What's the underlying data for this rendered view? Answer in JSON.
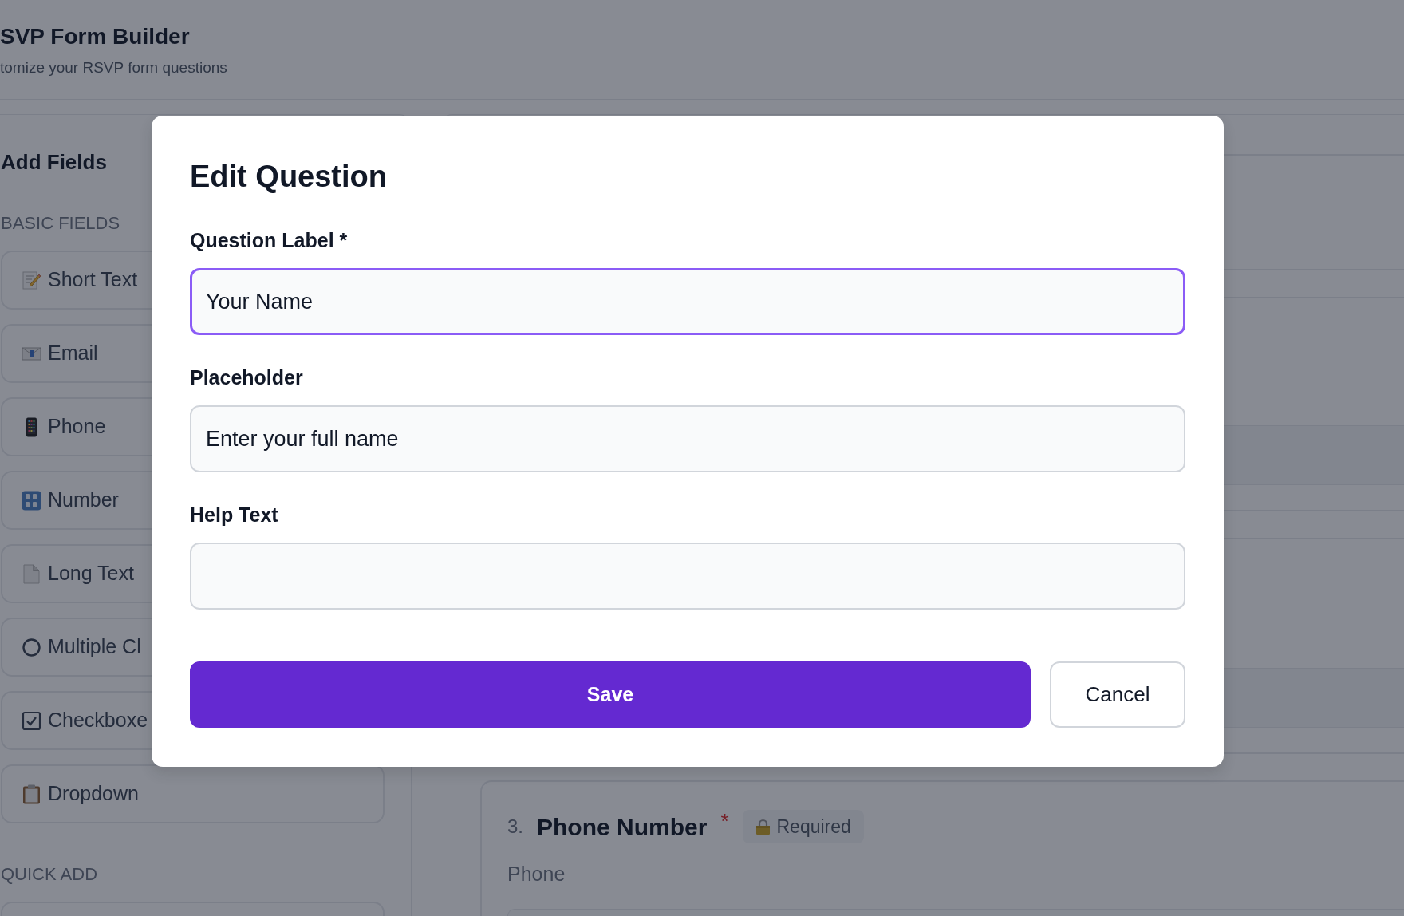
{
  "header": {
    "title": "SVP Form Builder",
    "subtitle": "tomize your RSVP form questions"
  },
  "sidebar": {
    "title": "Add Fields",
    "sections": [
      {
        "heading": "BASIC FIELDS",
        "items": [
          {
            "kind": "text",
            "label": "Short Text"
          },
          {
            "kind": "email",
            "label": "Email"
          },
          {
            "kind": "phone",
            "label": "Phone"
          },
          {
            "kind": "number",
            "label": "Number"
          },
          {
            "kind": "textarea",
            "label": "Long Text"
          },
          {
            "kind": "radio",
            "label": "Multiple Cl"
          },
          {
            "kind": "checkbox",
            "label": "Checkboxe"
          },
          {
            "kind": "dropdown",
            "label": "Dropdown"
          }
        ]
      },
      {
        "heading": "QUICK ADD"
      }
    ]
  },
  "questions": [
    {
      "number": "3.",
      "title": "Phone Number",
      "required_mark": "*",
      "badge": "Required",
      "type_label": "Phone"
    }
  ],
  "modal": {
    "title": "Edit Question",
    "fields": [
      {
        "label": "Question Label *",
        "value": "Your Name",
        "focused": true
      },
      {
        "label": "Placeholder",
        "value": "Enter your full name",
        "focused": false
      },
      {
        "label": "Help Text",
        "focused": false
      }
    ],
    "buttons": [
      {
        "kind": "save",
        "label": "Save"
      },
      {
        "kind": "cancel",
        "label": "Cancel"
      }
    ]
  }
}
